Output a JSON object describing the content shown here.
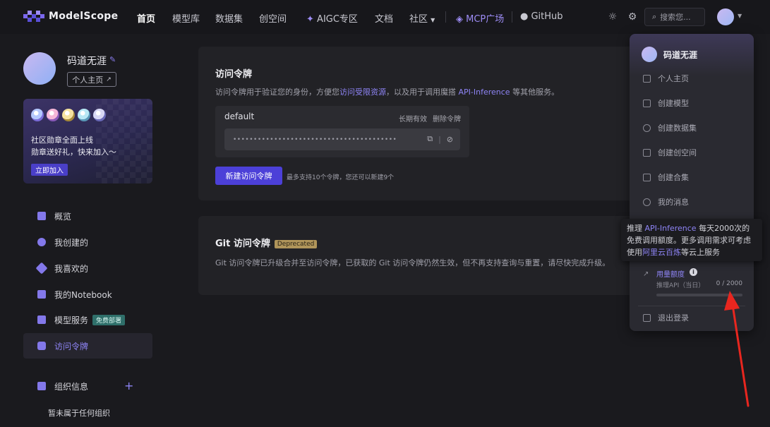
{
  "brand": {
    "name": "ModelScope"
  },
  "nav": {
    "items": [
      {
        "label": "首页",
        "active": true
      },
      {
        "label": "模型库"
      },
      {
        "label": "数据集"
      },
      {
        "label": "创空间"
      },
      {
        "label": "AIGC专区"
      },
      {
        "label": "文档"
      },
      {
        "label": "社区"
      },
      {
        "label": "MCP广场"
      },
      {
        "label": "GitHub"
      }
    ],
    "search_placeholder": "搜索您..."
  },
  "profile": {
    "name": "码道无涯",
    "home_button": "个人主页"
  },
  "banner": {
    "line1": "社区勋章全面上线",
    "line2": "勋章送好礼，快来加入～",
    "cta": "立即加入"
  },
  "sidebar": {
    "items": [
      {
        "label": "概览"
      },
      {
        "label": "我创建的"
      },
      {
        "label": "我喜欢的"
      },
      {
        "label": "我的Notebook"
      },
      {
        "label": "模型服务",
        "tag": "免费部署"
      },
      {
        "label": "访问令牌",
        "active": true
      }
    ],
    "org_title": "组织信息",
    "org_empty": "暂未属于任何组织"
  },
  "access_token": {
    "title": "访问令牌",
    "desc_pre": "访问令牌用于验证您的身份，方便您",
    "desc_link1": "访问受限资源",
    "desc_mid": "，以及用于调用魔搭 ",
    "desc_link2": "API-Inference",
    "desc_post": " 等其他服务。",
    "token": {
      "name": "default",
      "validity": "长期有效",
      "delete": "删除令牌",
      "masked": "••••••••••••••••••••••••••••••••••••••••"
    },
    "new_button": "新建访问令牌",
    "limit_note": "最多支持10个令牌，您还可以新建9个"
  },
  "git_token": {
    "title": "Git 访问令牌",
    "tag": "Deprecated",
    "desc": "Git 访问令牌已升级合并至访问令牌，已获取的 Git 访问令牌仍然生效，但不再支持查询与重置，请尽快完成升级。"
  },
  "dropdown": {
    "name": "码道无涯",
    "items": [
      {
        "label": "个人主页"
      },
      {
        "label": "创建模型"
      },
      {
        "label": "创建数据集"
      },
      {
        "label": "创建创空间"
      },
      {
        "label": "创建合集"
      },
      {
        "label": "我的消息"
      }
    ],
    "usage": {
      "label": "用量额度",
      "sub": "推理API（当日）",
      "count": "0 / 2000",
      "fraction": 0
    },
    "logout": "退出登录"
  },
  "tooltip": {
    "pre": "推理 ",
    "link1": "API-Inference",
    "mid": " 每天2000次的免费调用额度。更多调用需求可考虑使用",
    "link2": "阿里云百炼",
    "post": "等云上服务"
  }
}
